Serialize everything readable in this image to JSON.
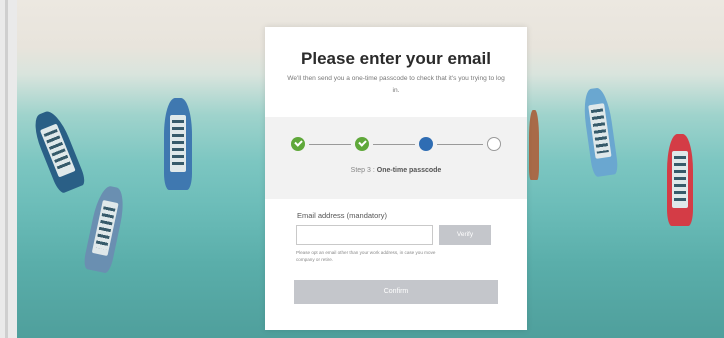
{
  "card": {
    "title": "Please enter your email",
    "subtitle": "We'll then send you a one-time passcode to check that it's you trying to log in."
  },
  "progress": {
    "steps": [
      {
        "state": "done",
        "icon": "check-icon"
      },
      {
        "state": "done",
        "icon": "check-icon"
      },
      {
        "state": "current",
        "icon": "dot-icon"
      },
      {
        "state": "todo",
        "icon": "empty-circle-icon"
      }
    ],
    "caption_prefix": "Step 3 : ",
    "caption_step": "One-time passcode"
  },
  "form": {
    "email_label": "Email address (mandatory)",
    "email_value": "",
    "verify_label": "Verify",
    "hint": "Please opt an email other than your work address, in case you move company or retire.",
    "confirm_label": "Confirm"
  },
  "colors": {
    "done": "#5fa83a",
    "current": "#2f6db3",
    "disabled_button": "#c4c6cb"
  }
}
